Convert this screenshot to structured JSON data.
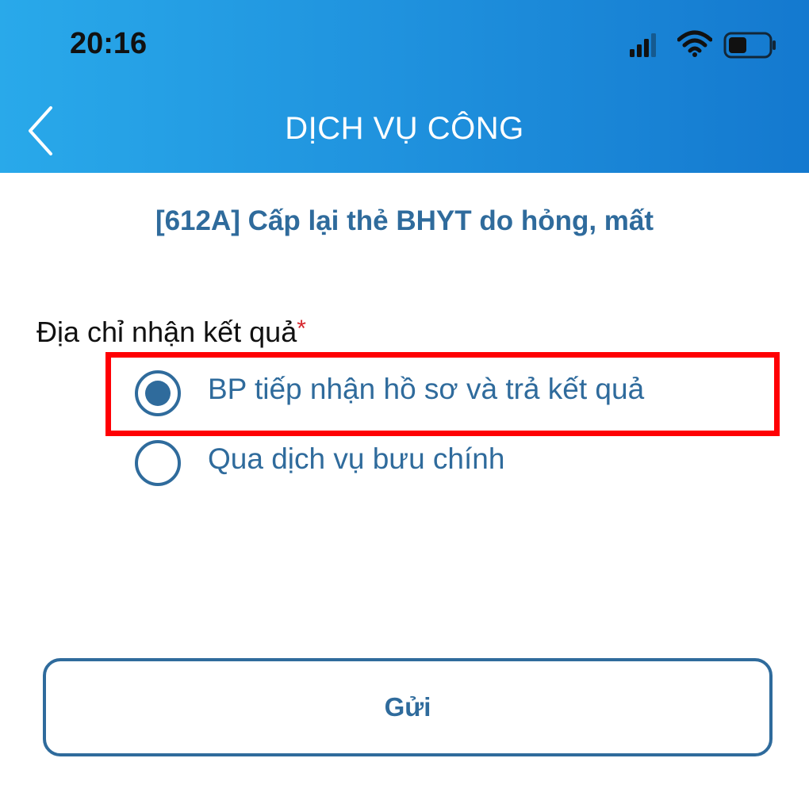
{
  "status_bar": {
    "time": "20:16",
    "icons": [
      "signal-icon",
      "wifi-icon",
      "battery-icon"
    ],
    "battery_level": 0.45
  },
  "nav": {
    "back_icon": "chevron-left-icon",
    "title": "DỊCH VỤ CÔNG"
  },
  "service_title": "[612A] Cấp lại thẻ BHYT do hỏng, mất",
  "form": {
    "field_label": "Địa chỉ nhận kết quả",
    "required_marker": "*",
    "options": [
      {
        "label": "BP tiếp nhận hồ sơ và trả kết quả",
        "selected": true
      },
      {
        "label": "Qua dịch vụ bưu chính",
        "selected": false
      }
    ],
    "submit_label": "Gửi"
  },
  "colors": {
    "header_gradient": [
      "#29a9ea",
      "#1479cf"
    ],
    "accent": "#2f6b9c",
    "highlight": "#ff0004",
    "required": "#d6262d"
  }
}
